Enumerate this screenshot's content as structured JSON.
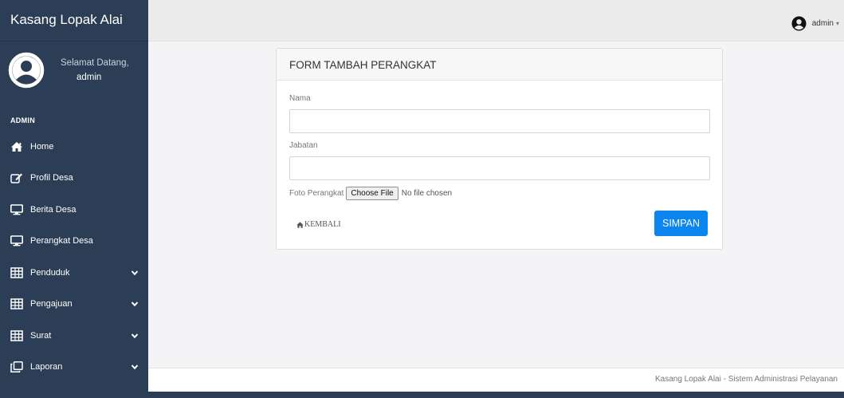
{
  "app": {
    "brand": "Kasang Lopak Alai"
  },
  "user_panel": {
    "greeting": "Selamat Datang,",
    "username": "admin"
  },
  "sidebar": {
    "section_header": "ADMIN",
    "items": [
      {
        "label": "Home",
        "icon": "home-icon",
        "has_submenu": false
      },
      {
        "label": "Profil Desa",
        "icon": "edit-icon",
        "has_submenu": false
      },
      {
        "label": "Berita Desa",
        "icon": "monitor-icon",
        "has_submenu": false
      },
      {
        "label": "Perangkat Desa",
        "icon": "monitor-icon",
        "has_submenu": false
      },
      {
        "label": "Penduduk",
        "icon": "table-icon",
        "has_submenu": true
      },
      {
        "label": "Pengajuan",
        "icon": "table-icon",
        "has_submenu": true
      },
      {
        "label": "Surat",
        "icon": "table-icon",
        "has_submenu": true
      },
      {
        "label": "Laporan",
        "icon": "copy-icon",
        "has_submenu": true
      }
    ]
  },
  "topbar": {
    "user_label": "admin"
  },
  "form": {
    "title": "FORM TAMBAH PERANGKAT",
    "nama_label": "Nama",
    "nama_value": "",
    "jabatan_label": "Jabatan",
    "jabatan_value": "",
    "foto_label": "Foto Perangkat",
    "file_button": "Choose File",
    "file_status": "No file chosen",
    "back_label": "KEMBALI",
    "submit_label": "SIMPAN"
  },
  "footer": {
    "text": "Kasang Lopak Alai - Sistem Administrasi Pelayanan"
  },
  "colors": {
    "sidebar_bg": "#2c3e55",
    "primary_button": "#0c86ee",
    "content_bg": "#f4f4f6"
  }
}
